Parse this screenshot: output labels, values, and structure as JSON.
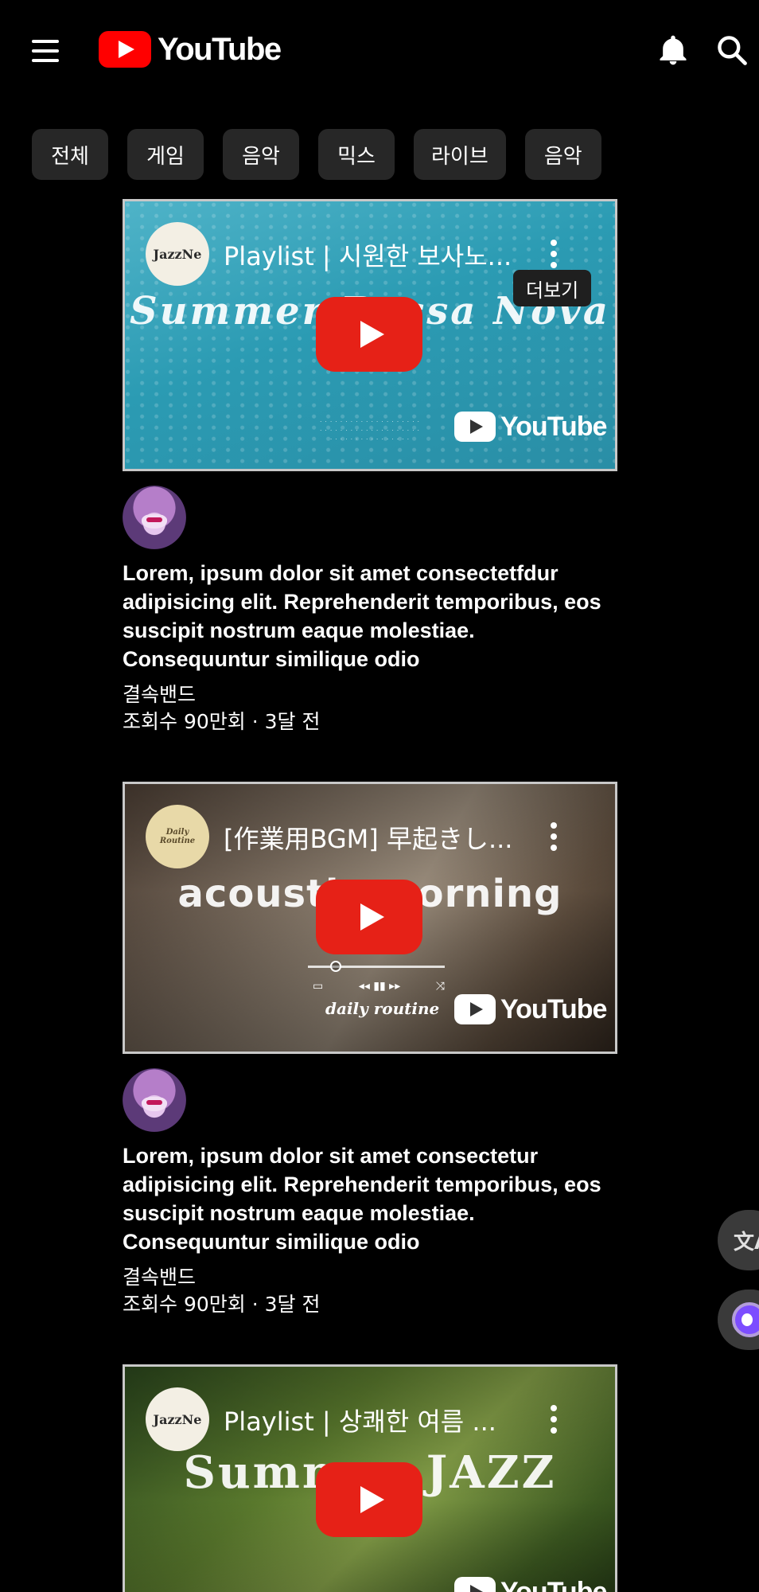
{
  "header": {
    "logo_text": "YouTube"
  },
  "chips": [
    "전체",
    "게임",
    "음악",
    "믹스",
    "라이브",
    "음악"
  ],
  "videos": [
    {
      "thumb_channel": "JazzNe",
      "thumb_title": "Playlist | 시원한 보사노...",
      "thumb_overlay_text": "Summer Bossa Nova",
      "thumb_tooltip": "더보기",
      "watermark": "YouTube",
      "title": "Lorem, ipsum dolor sit amet consectetfdur adipisicing elit. Reprehenderit temporibus, eos suscipit nostrum eaque molestiae. Consequuntur similique odio",
      "channel": "결속밴드",
      "stats": "조회수 90만회 · 3달 전"
    },
    {
      "thumb_channel": "Daily Routine",
      "thumb_title": "[作業用BGM] 早起きし...",
      "thumb_overlay_text": "acoustic morning",
      "thumb_subtext": "daily routine",
      "watermark": "YouTube",
      "title": "Lorem, ipsum dolor sit amet consectetur adipisicing elit. Reprehenderit temporibus, eos suscipit nostrum eaque molestiae. Consequuntur similique odio",
      "channel": "결속밴드",
      "stats": "조회수 90만회 · 3달 전"
    },
    {
      "thumb_channel": "JazzNe",
      "thumb_title": "Playlist | 상쾌한 여름 ...",
      "thumb_overlay_text": "Summer JAZZ",
      "watermark": "YouTube"
    }
  ],
  "floating": {
    "translate_label": "文A"
  },
  "colors": {
    "background": "#000000",
    "chip_bg": "#272727",
    "brand_red": "#ff0000",
    "play_red": "#e62117"
  },
  "icons": [
    "menu-icon",
    "youtube-logo",
    "bell-icon",
    "search-icon",
    "more-vert-icon",
    "play-icon",
    "translate-icon",
    "assistant-icon"
  ]
}
